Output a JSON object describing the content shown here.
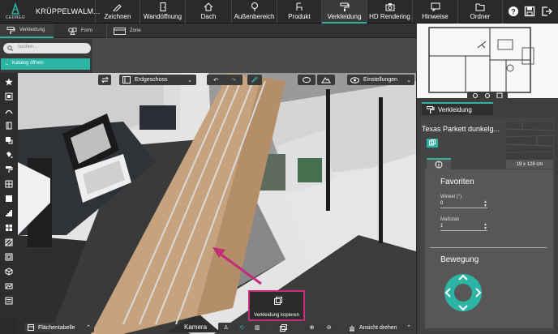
{
  "app": {
    "logo_text": "CEDREO",
    "project_name": "KRÜPPELWALM..."
  },
  "menu": [
    {
      "label": "Zeichnen",
      "icon": "pencil-icon"
    },
    {
      "label": "Wandöffnung",
      "icon": "door-icon"
    },
    {
      "label": "Dach",
      "icon": "roof-icon"
    },
    {
      "label": "Außenbereich",
      "icon": "tree-icon"
    },
    {
      "label": "Produkt",
      "icon": "chair-icon"
    },
    {
      "label": "Verkleidung",
      "icon": "paint-roller-icon",
      "active": true
    },
    {
      "label": "HD Rendering",
      "icon": "camera-icon"
    },
    {
      "label": "Hinweise",
      "icon": "message-icon"
    },
    {
      "label": "Ordner",
      "icon": "folder-icon"
    }
  ],
  "subtabs": [
    {
      "label": "Verkleidung",
      "icon": "paint-roller-icon",
      "active": true
    },
    {
      "label": "Form",
      "icon": "shapes-icon"
    },
    {
      "label": "Zone",
      "icon": "zone-icon"
    }
  ],
  "catalog": {
    "search_placeholder": "suchen...",
    "button_label": "Katalog öffnen"
  },
  "viewport_toolbar": {
    "floor": "Erdgeschoss",
    "settings": "Einstellungen"
  },
  "right_panel": {
    "tab_label": "Verkleidung",
    "material_title": "Texas Parkett dunkelg...",
    "material_size": "19 x 128 cm",
    "favorites_heading": "Favoriten",
    "angle_label": "Winkel (°)",
    "angle_value": "0",
    "scale_label": "Maßstab",
    "scale_value": "1",
    "movement_heading": "Bewegung"
  },
  "bottom": {
    "floor_table": "Flächentabelle",
    "camera_label": "Kamera",
    "rotate_view": "Ansicht drehen",
    "tooltip": "Verkleidung kopieren"
  },
  "colors": {
    "accent": "#2cb5a4",
    "highlight": "#c42c7c"
  }
}
